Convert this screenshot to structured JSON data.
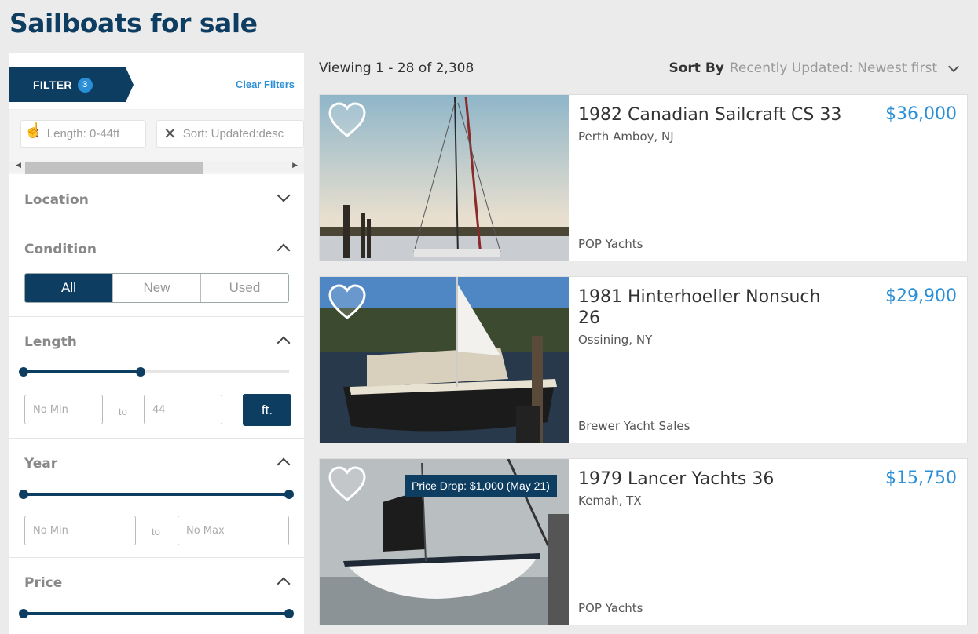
{
  "page": {
    "title": "Sailboats for sale"
  },
  "filter": {
    "label": "FILTER",
    "count": "3",
    "clear_label": "Clear Filters"
  },
  "chips": [
    {
      "label": "Length: 0-44ft"
    },
    {
      "label": "Sort: Updated:desc"
    }
  ],
  "sections": {
    "location": {
      "label": "Location"
    },
    "condition": {
      "label": "Condition",
      "options": [
        "All",
        "New",
        "Used"
      ],
      "selected": "All"
    },
    "length": {
      "label": "Length",
      "min_placeholder": "No Min",
      "to": "to",
      "max_value": "44",
      "unit": "ft.",
      "range_fraction": [
        0,
        0.44
      ]
    },
    "year": {
      "label": "Year",
      "min_placeholder": "No Min",
      "to": "to",
      "max_placeholder": "No Max",
      "range_fraction": [
        0,
        1
      ]
    },
    "price": {
      "label": "Price",
      "range_fraction": [
        0,
        1
      ]
    }
  },
  "results": {
    "viewing": "Viewing 1 - 28 of 2,308",
    "sort_label": "Sort By",
    "sort_value": "Recently Updated: Newest first"
  },
  "listings": [
    {
      "title": "1982 Canadian Sailcraft CS 33",
      "location": "Perth Amboy, NJ",
      "price": "$36,000",
      "broker": "POP Yachts"
    },
    {
      "title": "1981 Hinterhoeller Nonsuch 26",
      "location": "Ossining, NY",
      "price": "$29,900",
      "broker": "Brewer Yacht Sales"
    },
    {
      "title": "1979 Lancer Yachts 36",
      "location": "Kemah, TX",
      "price": "$15,750",
      "broker": "POP Yachts",
      "badge": "Price Drop: $1,000 (May 21)"
    }
  ],
  "colors": {
    "brand": "#0e3d62",
    "accent": "#2a8fd6"
  }
}
